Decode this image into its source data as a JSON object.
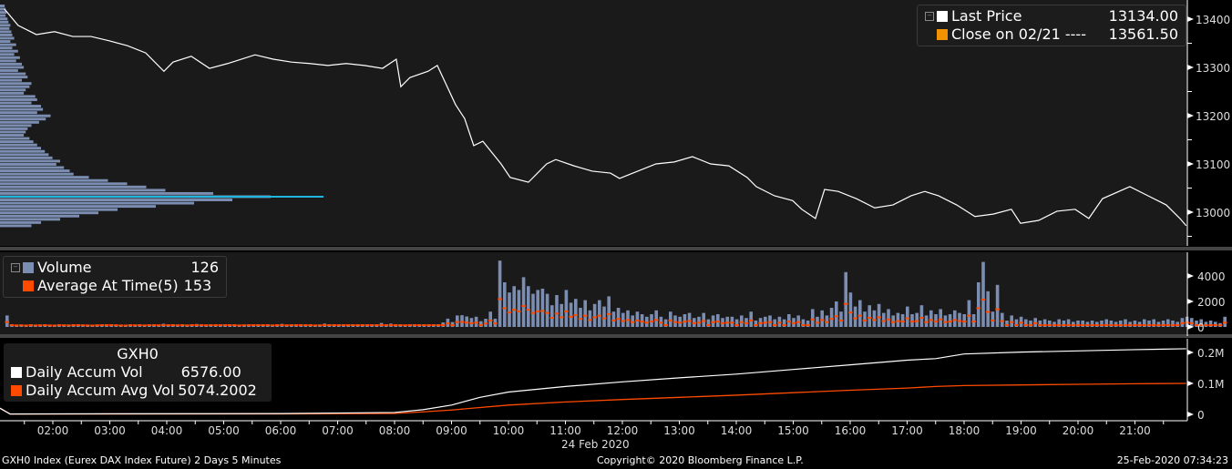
{
  "price_legend": {
    "items": [
      {
        "label": "Last Price",
        "value": "13134.00",
        "color": "#ffffff"
      },
      {
        "label": "Close on 02/21 ----",
        "value": "13561.50",
        "color": "#f39200"
      }
    ]
  },
  "volume_legend": {
    "items": [
      {
        "label": "Volume",
        "value": "126",
        "color": "#7b8db0"
      },
      {
        "label": "Average At Time(5)",
        "value": "153",
        "color": "#ff4a00"
      }
    ]
  },
  "accum_legend": {
    "title": "GXH0",
    "items": [
      {
        "label": "Daily Accum Vol",
        "value": "6576.00",
        "color": "#ffffff"
      },
      {
        "label": "Daily Accum Avg Vol",
        "value": "5074.2002",
        "color": "#ff4a00"
      }
    ]
  },
  "footer": {
    "left": "GXH0 Index (Eurex DAX Index Future) 2 Days 5 Minutes",
    "center": "Copyright© 2020 Bloomberg Finance L.P.",
    "right": "25-Feb-2020 07:34:23"
  },
  "date_label": "24 Feb 2020",
  "chart_data": [
    {
      "type": "line",
      "title": "Last Price",
      "ylim": [
        12940,
        13440
      ],
      "yticks": [
        "13000",
        "13100",
        "13200",
        "13300",
        "13400"
      ],
      "x_hours": [
        1.15,
        1.39,
        1.71,
        2.03,
        2.35,
        2.67,
        2.99,
        3.31,
        3.63,
        3.95,
        4.11,
        4.43,
        4.75,
        5.07,
        5.55,
        5.87,
        6.19,
        6.51,
        6.83,
        7.15,
        7.47,
        7.79,
        8.03,
        8.11,
        8.27,
        8.59,
        8.75,
        9.07,
        9.23,
        9.39,
        9.55,
        9.87,
        10.03,
        10.35,
        10.51,
        10.67,
        10.83,
        11.15,
        11.47,
        11.79,
        11.95,
        12.27,
        12.59,
        12.91,
        13.23,
        13.55,
        13.87,
        14.19,
        14.35,
        14.67,
        14.99,
        15.15,
        15.39,
        15.55,
        15.79,
        16.11,
        16.43,
        16.75,
        17.07,
        17.31,
        17.55,
        17.87,
        18.19,
        18.51,
        18.83,
        18.99,
        19.31,
        19.63,
        19.95,
        20.19,
        20.43,
        20.91,
        21.23,
        21.55,
        21.79,
        21.9
      ],
      "price": [
        13421,
        13387,
        13368,
        13374,
        13364,
        13364,
        13355,
        13345,
        13330,
        13292,
        13311,
        13323,
        13298,
        13308,
        13326,
        13317,
        13311,
        13308,
        13304,
        13308,
        13304,
        13298,
        13317,
        13260,
        13279,
        13292,
        13304,
        13223,
        13194,
        13138,
        13147,
        13100,
        13072,
        13062,
        13081,
        13100,
        13109,
        13096,
        13085,
        13081,
        13070,
        13085,
        13100,
        13104,
        13115,
        13100,
        13096,
        13072,
        13053,
        13034,
        13024,
        13006,
        12987,
        13047,
        13043,
        13028,
        13009,
        13015,
        13034,
        13043,
        13034,
        13015,
        12991,
        12996,
        13006,
        12977,
        12983,
        13002,
        13006,
        12987,
        13028,
        13053,
        13034,
        13015,
        12987,
        12972
      ],
      "volume_profile_relative": [
        2,
        3,
        4,
        3,
        5,
        6,
        8,
        7,
        9,
        10,
        12,
        8,
        14,
        10,
        16,
        12,
        18,
        14,
        20,
        22,
        16,
        24,
        26,
        20,
        30,
        28,
        24,
        22,
        34,
        36,
        30,
        40,
        42,
        36,
        50,
        45,
        38,
        30,
        26,
        24,
        22,
        28,
        32,
        36,
        40,
        44,
        48,
        52,
        60,
        56,
        64,
        70,
        74,
        90,
        110,
        130,
        150,
        170,
        220,
        280,
        240,
        200,
        160,
        120,
        100,
        80,
        60,
        40,
        30
      ],
      "volume_profile_poc": 13032
    },
    {
      "type": "bar",
      "title": "Volume",
      "ylim": [
        0,
        5500
      ],
      "yticks": [
        "0",
        "2000",
        "4000"
      ],
      "volume": [
        900,
        150,
        120,
        130,
        110,
        140,
        120,
        130,
        150,
        120,
        110,
        140,
        130,
        120,
        150,
        140,
        130,
        120,
        110,
        130,
        150,
        140,
        160,
        130,
        120,
        110,
        140,
        130,
        150,
        120,
        140,
        160,
        130,
        250,
        170,
        160,
        130,
        200,
        120,
        180,
        230,
        150,
        130,
        140,
        190,
        140,
        170,
        200,
        160,
        120,
        130,
        150,
        170,
        140,
        180,
        140,
        120,
        190,
        240,
        130,
        150,
        200,
        170,
        160,
        140,
        120,
        130,
        260,
        200,
        180,
        160,
        170,
        150,
        190,
        200,
        160,
        170,
        150,
        200,
        310,
        180,
        260,
        190,
        150,
        130,
        170,
        200,
        180,
        190,
        160,
        150,
        190,
        350,
        650,
        380,
        900,
        920,
        820,
        700,
        800,
        450,
        640,
        1200,
        650,
        5200,
        3500,
        2700,
        3200,
        2900,
        3900,
        3200,
        2600,
        2900,
        3000,
        2600,
        1700,
        2500,
        1800,
        2900,
        1900,
        2200,
        1500,
        2100,
        1300,
        1800,
        2100,
        1600,
        2400,
        1200,
        1500,
        1100,
        1300,
        900,
        1200,
        1000,
        800,
        1000,
        1300,
        800,
        600,
        1200,
        900,
        800,
        1000,
        1100,
        700,
        800,
        1100,
        600,
        900,
        1000,
        700,
        800,
        800,
        600,
        900,
        700,
        1200,
        500,
        700,
        800,
        900,
        600,
        800,
        600,
        1000,
        700,
        900,
        600,
        500,
        1400,
        800,
        1300,
        900,
        1500,
        2000,
        1200,
        4300,
        2700,
        1600,
        2100,
        1200,
        1700,
        1300,
        1800,
        1100,
        1400,
        900,
        1100,
        1000,
        1600,
        1000,
        1100,
        1700,
        900,
        1300,
        1000,
        1400,
        900,
        1000,
        1300,
        1100,
        1000,
        2100,
        1000,
        3500,
        5100,
        2800,
        1200,
        3300,
        1100,
        500,
        900,
        600,
        800,
        600,
        500,
        700,
        500,
        600,
        500,
        400,
        600,
        500,
        600,
        400,
        500,
        500,
        400,
        500,
        400,
        500,
        600,
        500,
        400,
        500,
        600,
        400,
        500,
        400,
        600,
        500,
        600,
        400,
        500,
        600,
        500,
        400,
        700,
        800,
        700,
        500,
        600,
        400,
        500,
        400,
        300,
        800
      ],
      "avg_note": "average at time shown as dashes, approx 0.45 of volume during session"
    },
    {
      "type": "line",
      "title": "Daily Accum Vol",
      "ylim": [
        -20000,
        230000
      ],
      "yticks": [
        "0",
        "0.1M",
        "0.2M"
      ],
      "x_hours": [
        1.07,
        1.25,
        2,
        6,
        8,
        8.5,
        9,
        9.5,
        10,
        11,
        12,
        13,
        14,
        15,
        16,
        17,
        17.5,
        18,
        19,
        20,
        21,
        21.9
      ],
      "accum_vol": [
        20000,
        1000,
        1500,
        2500,
        6000,
        15000,
        30000,
        55000,
        72000,
        90000,
        105000,
        118000,
        130000,
        145000,
        160000,
        175000,
        180000,
        195000,
        201000,
        205000,
        209000,
        212000
      ],
      "accum_avg": [
        20000,
        1000,
        1200,
        1500,
        3000,
        8000,
        14000,
        22000,
        30000,
        40000,
        48000,
        55000,
        62000,
        70000,
        78000,
        85000,
        90000,
        93000,
        95000,
        97000,
        99000,
        100000
      ]
    },
    {
      "type": "axis",
      "xticks": [
        "02:00",
        "03:00",
        "04:00",
        "05:00",
        "06:00",
        "07:00",
        "08:00",
        "09:00",
        "10:00",
        "11:00",
        "12:00",
        "13:00",
        "14:00",
        "15:00",
        "16:00",
        "17:00",
        "18:00",
        "19:00",
        "20:00",
        "21:00"
      ]
    }
  ]
}
